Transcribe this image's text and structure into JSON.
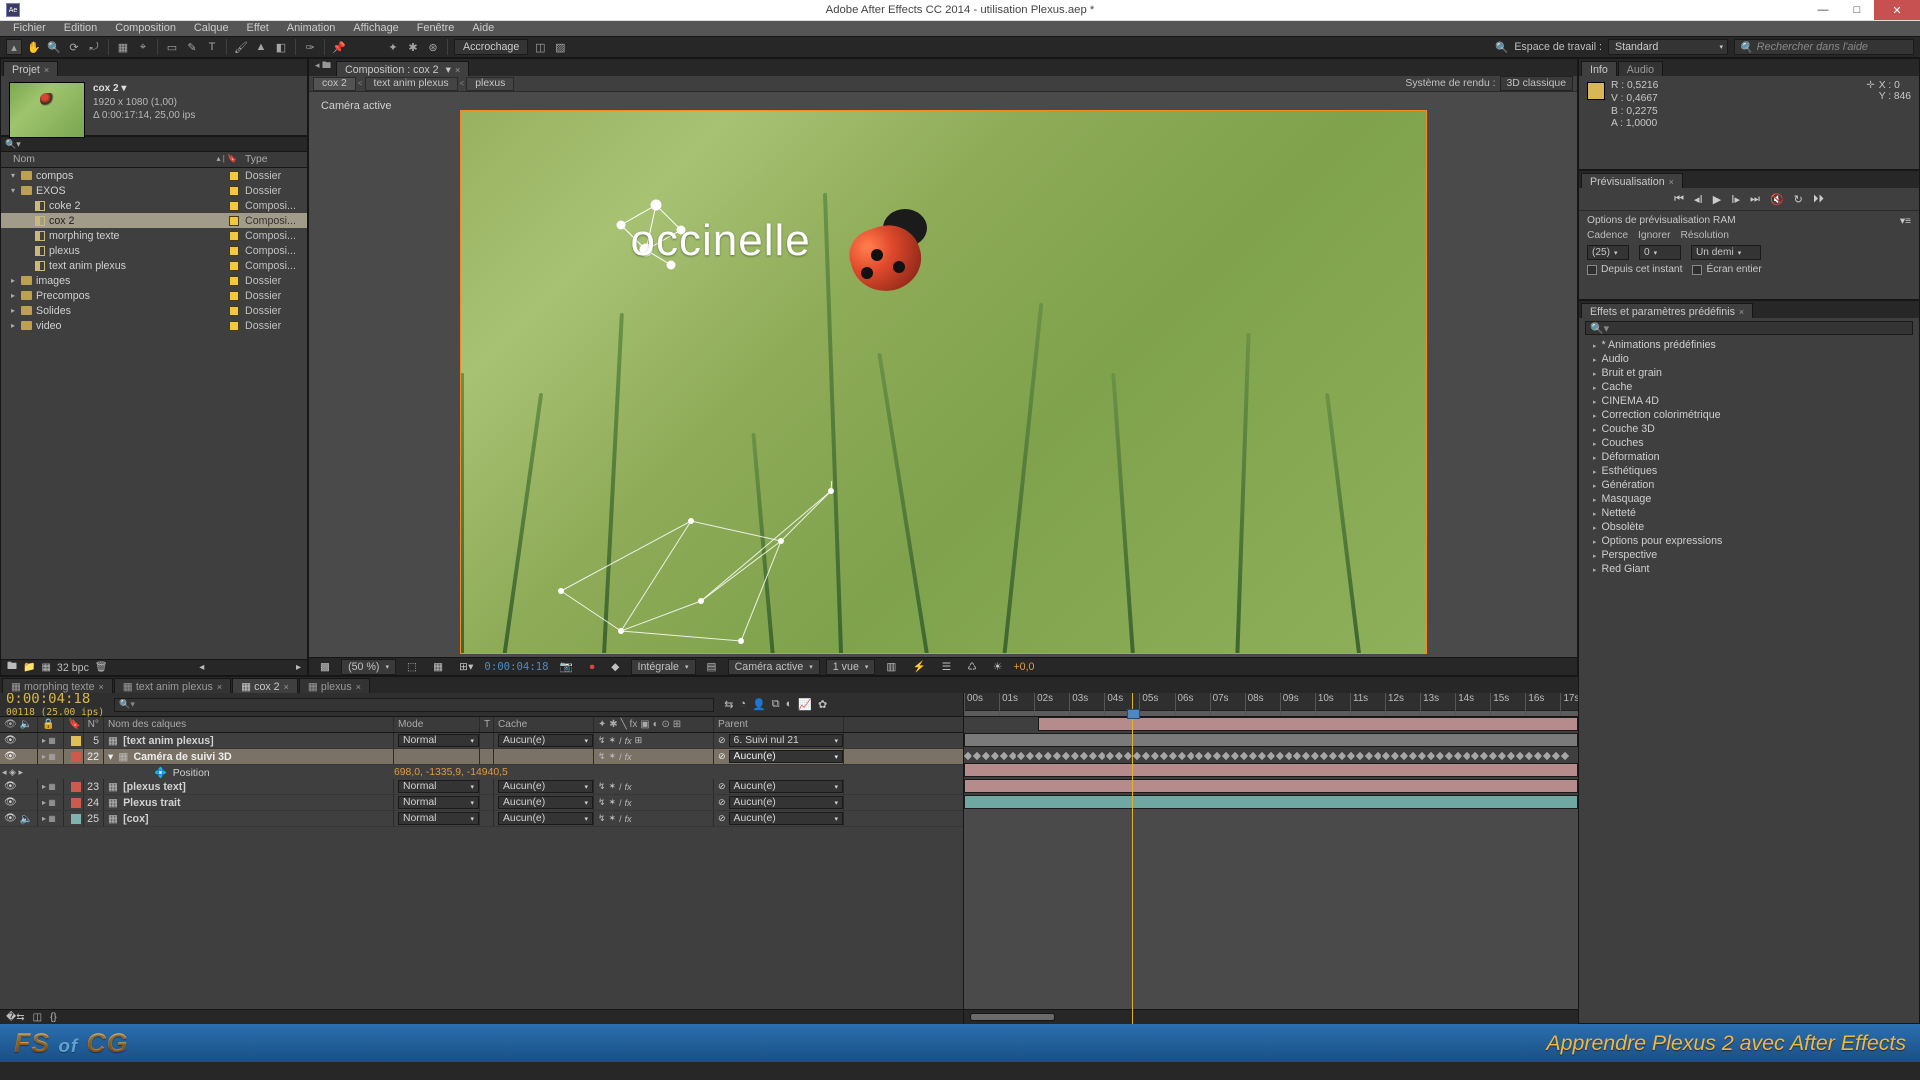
{
  "title": "Adobe After Effects CC 2014 - utilisation Plexus.aep *",
  "app_initials": "Ae",
  "menu": [
    "Fichier",
    "Edition",
    "Composition",
    "Calque",
    "Effet",
    "Animation",
    "Affichage",
    "Fenêtre",
    "Aide"
  ],
  "toolbar": {
    "snap_label": "Accrochage",
    "workspace_lbl": "Espace de travail :",
    "workspace_value": "Standard",
    "search_ph": "Rechercher dans l'aide"
  },
  "project": {
    "tab": "Projet",
    "selected": {
      "name": "cox 2 ▾",
      "res": "1920 x 1080 (1,00)",
      "dur": "Δ 0:00:17:14, 25,00 ips"
    },
    "headers": {
      "name": "Nom",
      "label": "",
      "type": "Type"
    },
    "tree": [
      {
        "depth": 0,
        "tw": "▾",
        "icon": "folder",
        "name": "compos",
        "type": "Dossier"
      },
      {
        "depth": 0,
        "tw": "▾",
        "icon": "folder",
        "name": "EXOS",
        "type": "Dossier"
      },
      {
        "depth": 1,
        "tw": "",
        "icon": "comp",
        "name": "coke 2",
        "type": "Composi..."
      },
      {
        "depth": 1,
        "tw": "",
        "icon": "comp",
        "name": "cox 2",
        "type": "Composi...",
        "sel": true
      },
      {
        "depth": 1,
        "tw": "",
        "icon": "comp",
        "name": "morphing texte",
        "type": "Composi..."
      },
      {
        "depth": 1,
        "tw": "",
        "icon": "comp",
        "name": "plexus",
        "type": "Composi..."
      },
      {
        "depth": 1,
        "tw": "",
        "icon": "comp",
        "name": "text anim plexus",
        "type": "Composi..."
      },
      {
        "depth": 0,
        "tw": "▸",
        "icon": "folder",
        "name": "images",
        "type": "Dossier"
      },
      {
        "depth": 0,
        "tw": "▸",
        "icon": "folder",
        "name": "Precompos",
        "type": "Dossier"
      },
      {
        "depth": 0,
        "tw": "▸",
        "icon": "folder",
        "name": "Solides",
        "type": "Dossier"
      },
      {
        "depth": 0,
        "tw": "▸",
        "icon": "folder",
        "name": "video",
        "type": "Dossier"
      }
    ],
    "footer_bpc": "32 bpc"
  },
  "comp": {
    "tab": "Composition : cox 2",
    "breadcrumbs": [
      "cox 2",
      "text anim plexus",
      "plexus"
    ],
    "render_label": "Système de rendu :",
    "render_mode": "3D classique",
    "active_cam": "Caméra active",
    "overlay_text": "occinelle",
    "footer": {
      "mag": "(50 %)",
      "tc": "0:00:04:18",
      "quality": "Intégrale",
      "view": "Caméra active",
      "views": "1 vue",
      "exposure": "+0,0"
    }
  },
  "info": {
    "tab_info": "Info",
    "tab_audio": "Audio",
    "R": "R : 0,5216",
    "G": "V : 0,4667",
    "B": "B : 0,2275",
    "A": "A : 1,0000",
    "X": "X : 0",
    "Y": "Y : 846"
  },
  "preview": {
    "tab": "Prévisualisation",
    "ram_title": "Options de prévisualisation RAM",
    "hdr": {
      "cad": "Cadence",
      "ign": "Ignorer",
      "res": "Résolution"
    },
    "cad": "(25)",
    "ign": "0",
    "res": "Un demi",
    "chk_from": "Depuis cet instant",
    "chk_full": "Écran entier"
  },
  "effects": {
    "tab": "Effets et paramètres prédéfinis",
    "items": [
      "* Animations prédéfinies",
      "Audio",
      "Bruit et grain",
      "Cache",
      "CINEMA 4D",
      "Correction colorimétrique",
      "Couche 3D",
      "Couches",
      "Déformation",
      "Esthétiques",
      "Génération",
      "Masquage",
      "Netteté",
      "Obsolète",
      "Options pour expressions",
      "Perspective",
      "Red Giant"
    ]
  },
  "timeline": {
    "tabs": [
      "morphing texte",
      "text anim plexus",
      "cox 2",
      "plexus"
    ],
    "active_tab": 2,
    "tc": "0:00:04:18",
    "tc_sub": "00118 (25.00 ips)",
    "col_hdr": {
      "num": "N°",
      "name": "Nom des calques",
      "mode": "Mode",
      "t": "T",
      "cache": "Cache",
      "parent": "Parent"
    },
    "layers": [
      {
        "n": "5",
        "color": "#e0bf58",
        "name": "[text anim plexus]",
        "mode": "Normal",
        "cache": "Aucun(e)",
        "parent": "6. Suivi nul 21",
        "is3d": true
      },
      {
        "n": "22",
        "color": "#cf5a4b",
        "name": "Caméra de suivi 3D",
        "mode": "",
        "cache": "",
        "parent": "Aucun(e)",
        "sel": true,
        "is3d": false
      },
      {
        "n": "23",
        "color": "#cf5a4b",
        "name": "[plexus text]",
        "mode": "Normal",
        "cache": "Aucun(e)",
        "parent": "Aucun(e)"
      },
      {
        "n": "24",
        "color": "#cf5a4b",
        "name": "Plexus trait",
        "mode": "Normal",
        "cache": "Aucun(e)",
        "parent": "Aucun(e)"
      },
      {
        "n": "25",
        "color": "#7fb3b0",
        "name": "[cox]",
        "mode": "Normal",
        "cache": "Aucun(e)",
        "parent": "Aucun(e)"
      }
    ],
    "prop": {
      "name": "Position",
      "value": "698,0, -1335,9, -14940,5"
    },
    "ruler": [
      "00s",
      "01s",
      "02s",
      "03s",
      "04s",
      "05s",
      "06s",
      "07s",
      "08s",
      "09s",
      "10s",
      "11s",
      "12s",
      "13s",
      "14s",
      "15s",
      "16s",
      "17s"
    ],
    "cti_pct": 27.4
  },
  "taskbar": {
    "brand_a": "FS",
    "brand_of": "of",
    "brand_b": "CG",
    "lesson": "Apprendre Plexus 2 avec After Effects"
  }
}
